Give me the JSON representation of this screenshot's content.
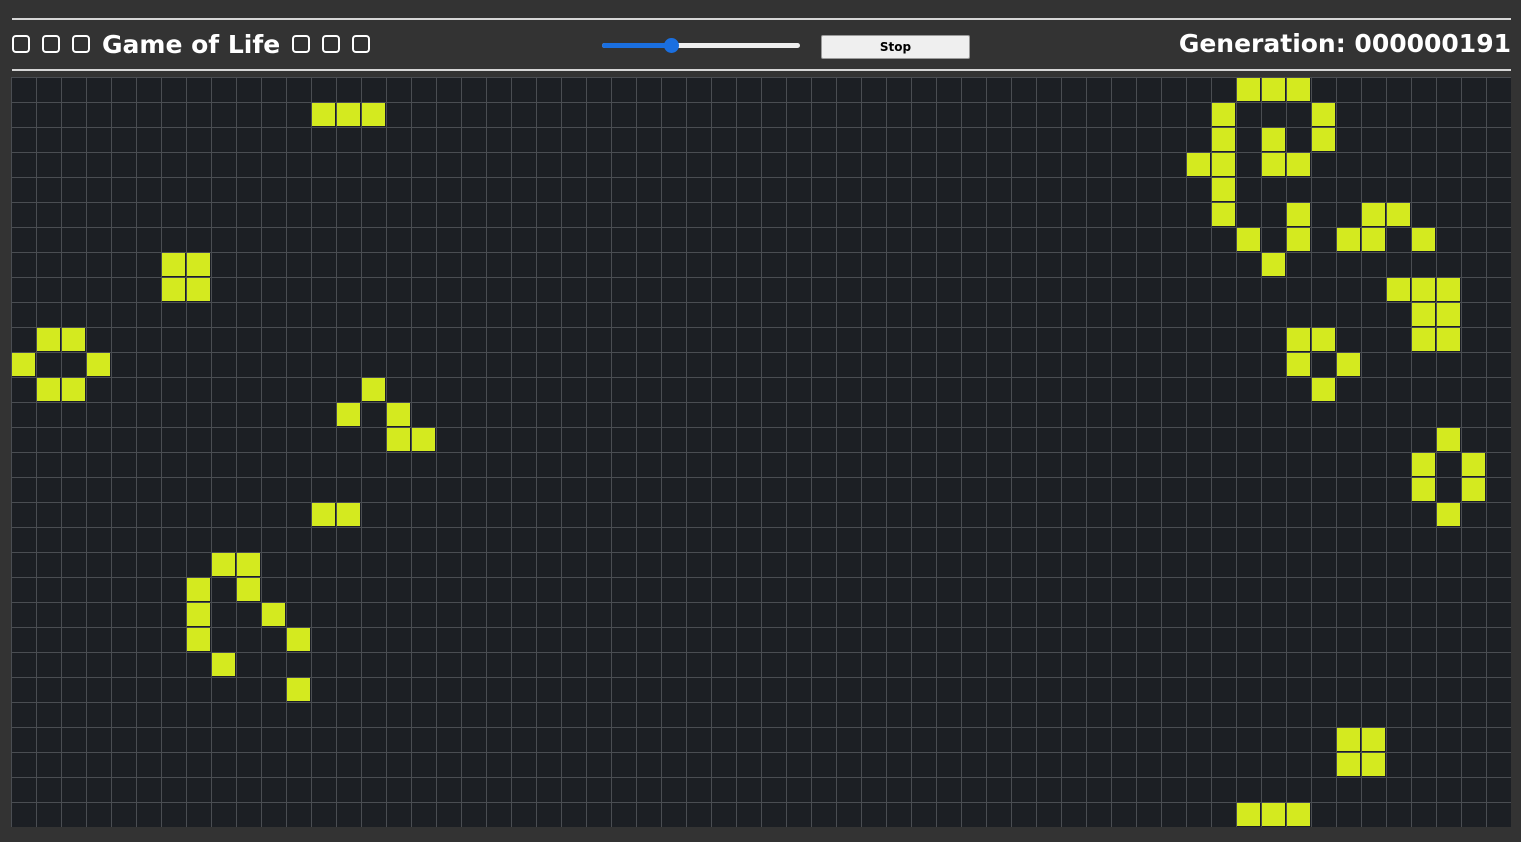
{
  "header": {
    "title": "Game of Life",
    "generation_label": "Generation: 000000191",
    "stop_label": "Stop",
    "speed_value": 0.35
  },
  "colors": {
    "background": "#333333",
    "grid_background": "#1c1f24",
    "grid_line": "#4a4d52",
    "live_cell": "#d4ea1f",
    "slider_accent": "#1a6fe0"
  },
  "board": {
    "columns": 60,
    "rows": 30,
    "live_cells": [
      [
        49,
        0
      ],
      [
        50,
        0
      ],
      [
        51,
        0
      ],
      [
        12,
        1
      ],
      [
        13,
        1
      ],
      [
        14,
        1
      ],
      [
        48,
        1
      ],
      [
        52,
        1
      ],
      [
        48,
        2
      ],
      [
        50,
        2
      ],
      [
        52,
        2
      ],
      [
        47,
        3
      ],
      [
        48,
        3
      ],
      [
        50,
        3
      ],
      [
        51,
        3
      ],
      [
        48,
        4
      ],
      [
        48,
        5
      ],
      [
        51,
        5
      ],
      [
        54,
        5
      ],
      [
        55,
        5
      ],
      [
        49,
        6
      ],
      [
        51,
        6
      ],
      [
        53,
        6
      ],
      [
        54,
        6
      ],
      [
        56,
        6
      ],
      [
        6,
        7
      ],
      [
        7,
        7
      ],
      [
        50,
        7
      ],
      [
        6,
        8
      ],
      [
        7,
        8
      ],
      [
        55,
        8
      ],
      [
        56,
        8
      ],
      [
        57,
        8
      ],
      [
        56,
        9
      ],
      [
        57,
        9
      ],
      [
        1,
        10
      ],
      [
        2,
        10
      ],
      [
        51,
        10
      ],
      [
        52,
        10
      ],
      [
        56,
        10
      ],
      [
        57,
        10
      ],
      [
        0,
        11
      ],
      [
        3,
        11
      ],
      [
        51,
        11
      ],
      [
        53,
        11
      ],
      [
        1,
        12
      ],
      [
        2,
        12
      ],
      [
        14,
        12
      ],
      [
        52,
        12
      ],
      [
        13,
        13
      ],
      [
        15,
        13
      ],
      [
        15,
        14
      ],
      [
        16,
        14
      ],
      [
        57,
        14
      ],
      [
        56,
        15
      ],
      [
        58,
        15
      ],
      [
        56,
        16
      ],
      [
        58,
        16
      ],
      [
        12,
        17
      ],
      [
        13,
        17
      ],
      [
        57,
        17
      ],
      [
        8,
        19
      ],
      [
        9,
        19
      ],
      [
        7,
        20
      ],
      [
        9,
        20
      ],
      [
        7,
        21
      ],
      [
        10,
        21
      ],
      [
        7,
        22
      ],
      [
        11,
        22
      ],
      [
        8,
        23
      ],
      [
        11,
        24
      ],
      [
        53,
        26
      ],
      [
        54,
        26
      ],
      [
        53,
        27
      ],
      [
        54,
        27
      ],
      [
        49,
        29
      ],
      [
        50,
        29
      ],
      [
        51,
        29
      ]
    ]
  }
}
